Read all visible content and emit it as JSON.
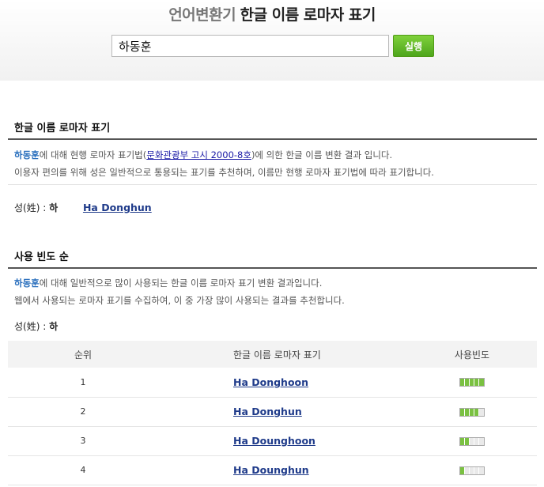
{
  "header": {
    "title_light": "언어변환기",
    "title_strong": "한글 이름 로마자 표기"
  },
  "search": {
    "value": "하동훈",
    "button_label": "실행"
  },
  "section1": {
    "title": "한글 이름 로마자 표기",
    "name": "하동훈",
    "line1_a": "에 대해 현행 로마자 표기법(",
    "line1_link": "문화관광부 고시 2000-8호",
    "line1_b": ")에 의한 한글 이름 변환 결과 입니다.",
    "line2": "이용자 편의를 위해 성은 일반적으로 통용되는 표기를 추천하며, 이름만 현행 로마자 표기법에 따라 표기합니다.",
    "surname_label": "성(姓) : ",
    "surname_value": "하",
    "result": "Ha Donghun"
  },
  "section2": {
    "title": "사용 빈도 순",
    "name": "하동훈",
    "line1": "에 대해 일반적으로 많이 사용되는 한글 이름 로마자 표기 변환 결과입니다.",
    "line2": "웹에서 사용되는 로마자 표기를 수집하여, 이 중 가장 많이 사용되는 결과를 추천합니다.",
    "surname_label": "성(姓) : ",
    "surname_value": "하"
  },
  "table": {
    "headers": [
      "순위",
      "한글 이름 로마자 표기",
      "사용빈도"
    ],
    "rows": [
      {
        "rank": "1",
        "name": "Ha Donghoon",
        "freq": 5
      },
      {
        "rank": "2",
        "name": "Ha Donghun",
        "freq": 4
      },
      {
        "rank": "3",
        "name": "Ha Dounghoon",
        "freq": 2
      },
      {
        "rank": "4",
        "name": "Ha Dounghun",
        "freq": 1
      }
    ],
    "freq_max": 5
  },
  "colors": {
    "accent_green": "#5fb52a",
    "link_blue": "#1f3b8a",
    "name_highlight": "#2a6fbd"
  }
}
